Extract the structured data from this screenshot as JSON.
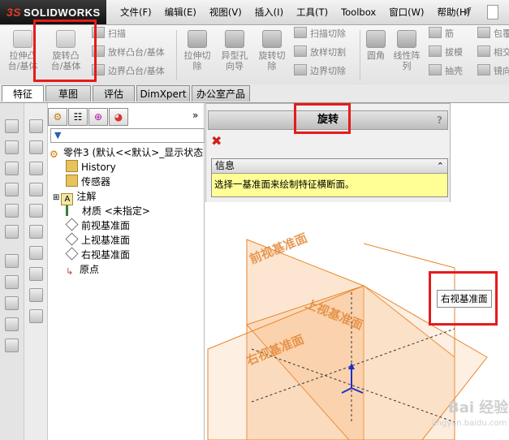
{
  "app": {
    "brand": "SOLIDWORKS",
    "brand_prefix": "3S"
  },
  "menu": [
    "文件(F)",
    "编辑(E)",
    "视图(V)",
    "插入(I)",
    "工具(T)",
    "Toolbox",
    "窗口(W)",
    "帮助(H)"
  ],
  "ribbon": {
    "extrude_boss": "拉伸凸\n台/基体",
    "revolve_boss": "旋转凸\n台/基体",
    "sweep": "扫描",
    "loft": "放样凸台/基体",
    "boundary": "边界凸台/基体",
    "extrude_cut": "拉伸切\n除",
    "hole_wizard": "异型孔\n向导",
    "revolve_cut": "旋转切\n除",
    "sweep_cut": "扫描切除",
    "loft_cut": "放样切割",
    "boundary_cut": "边界切除",
    "fillet": "圆角",
    "linear_pattern": "线性阵\n列",
    "rib": "筋",
    "draft": "拔模",
    "shell": "抽壳",
    "wrap": "包覆",
    "intersect": "相交",
    "mirror": "镜向"
  },
  "tabs": [
    "特征",
    "草图",
    "评估",
    "DimXpert",
    "办公室产品"
  ],
  "tree": {
    "root": "零件3  (默认<<默认>_显示状态",
    "items": [
      "History",
      "传感器",
      "注解",
      "材质 <未指定>",
      "前视基准面",
      "上视基准面",
      "右视基准面",
      "原点"
    ]
  },
  "property_manager": {
    "title": "旋转",
    "help": "?",
    "info_header": "信息",
    "info_message": "选择一基准面来绘制特征横断面。"
  },
  "viewport": {
    "plane_front": "前视基准面",
    "plane_top": "上视基准面",
    "plane_right": "右视基准面",
    "tooltip": "右视基准面"
  },
  "watermark": {
    "text": "Bai 经验",
    "url": "jingyan.baidu.com"
  },
  "colors": {
    "plane": "#f6b77a",
    "plane_edge": "#e8862c",
    "plane_label": "#e3893a",
    "callout": "#e51b1b",
    "info_bg": "#ffff96"
  }
}
